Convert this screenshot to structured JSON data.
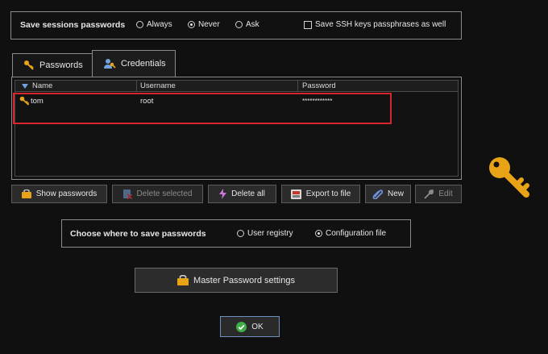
{
  "save_sessions": {
    "label": "Save sessions passwords",
    "options": [
      "Always",
      "Never",
      "Ask"
    ],
    "selected": "Never",
    "ssh_checkbox_label": "Save SSH keys passphrases as well",
    "ssh_checked": false
  },
  "tabs": [
    {
      "label": "Passwords",
      "icon": "key-icon",
      "active": false
    },
    {
      "label": "Credentials",
      "icon": "user-key-icon",
      "active": true
    }
  ],
  "table": {
    "columns": [
      "Name",
      "Username",
      "Password"
    ],
    "rows": [
      {
        "name": "tom",
        "username": "root",
        "password": "************"
      }
    ]
  },
  "buttons": {
    "show_passwords": "Show passwords",
    "delete_selected": "Delete selected",
    "delete_all": "Delete all",
    "export": "Export to file",
    "new": "New",
    "edit": "Edit"
  },
  "where_to_save": {
    "label": "Choose where to save passwords",
    "options": [
      "User registry",
      "Configuration file"
    ],
    "selected": "Configuration file"
  },
  "master_password_label": "Master Password settings",
  "ok_label": "OK",
  "colors": {
    "background": "#101010",
    "highlight_border": "#d6252c",
    "key_gold": "#e8a317"
  }
}
